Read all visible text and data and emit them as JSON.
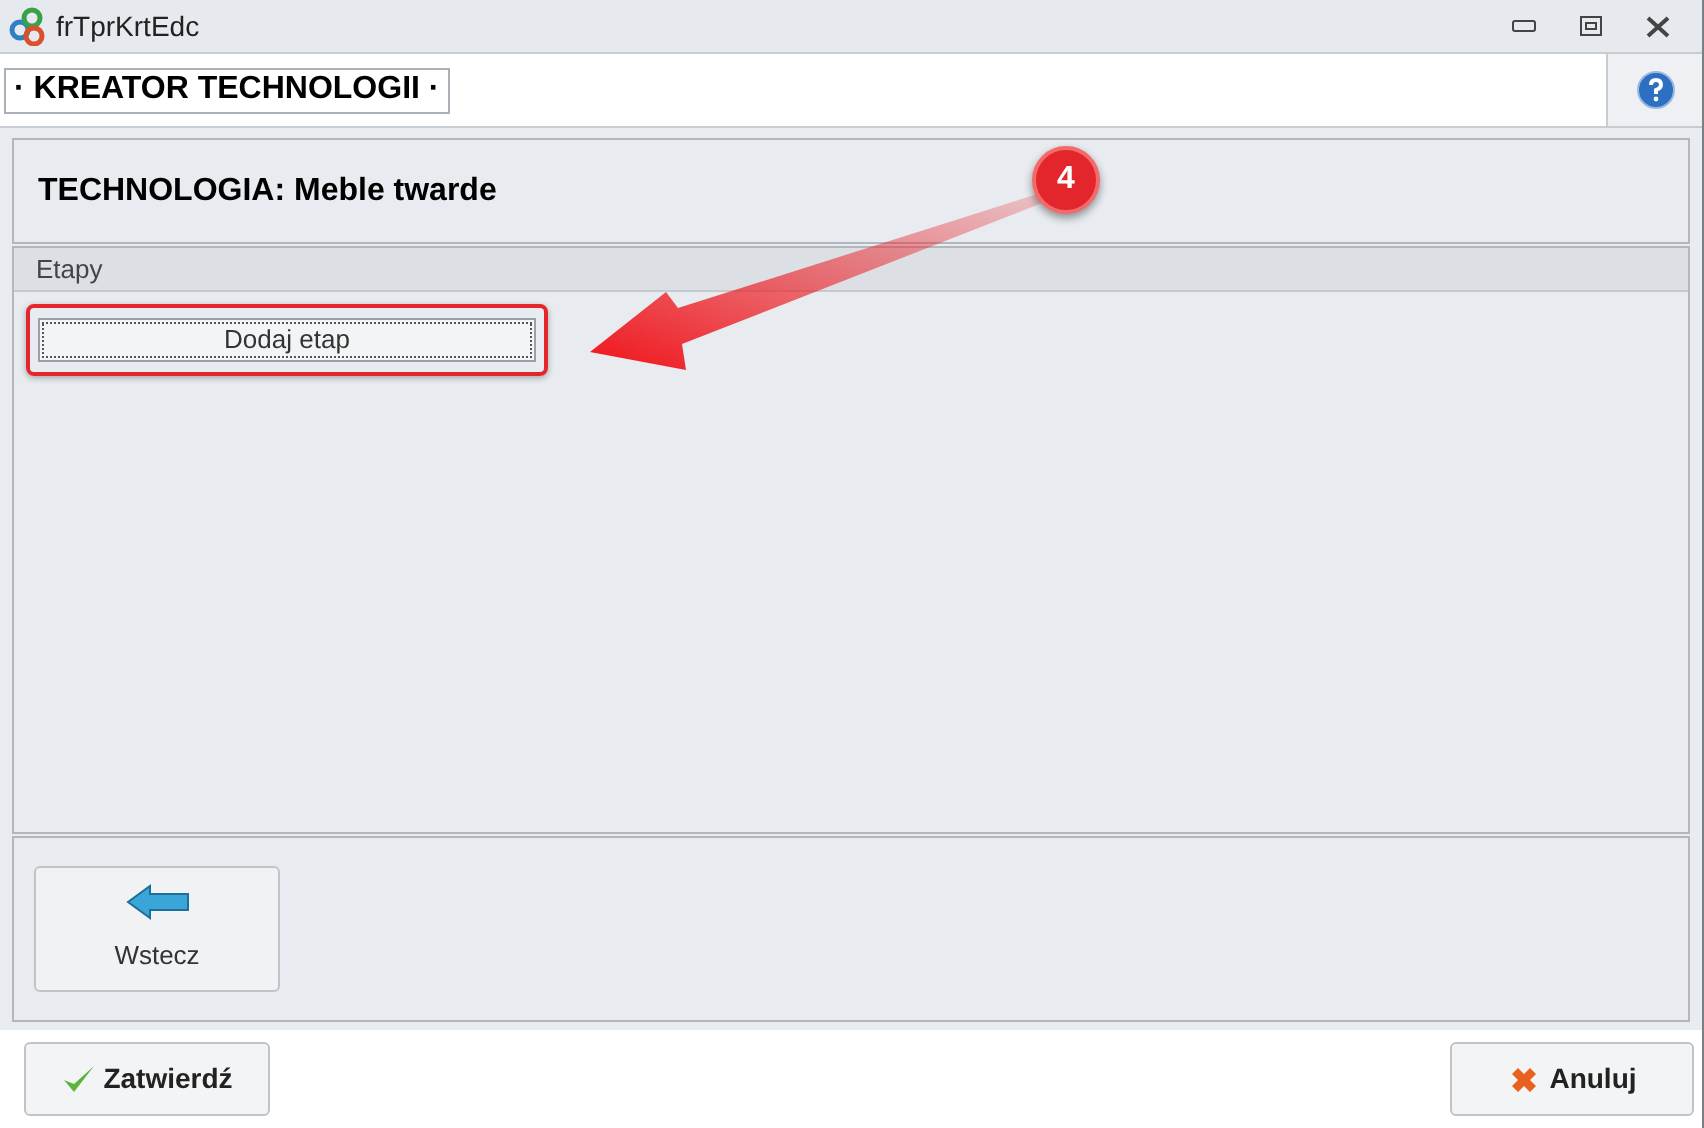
{
  "window": {
    "title": "frTprKrtEdc"
  },
  "header": {
    "title": "· KREATOR TECHNOLOGII ·"
  },
  "technology": {
    "title": "TECHNOLOGIA: Meble twarde"
  },
  "stages": {
    "label": "Etapy",
    "add_button": "Dodaj etap",
    "highlighted": true
  },
  "annotation": {
    "number": "4"
  },
  "back_button": "Wstecz",
  "footer": {
    "confirm": "Zatwierdź",
    "cancel": "Anuluj"
  }
}
